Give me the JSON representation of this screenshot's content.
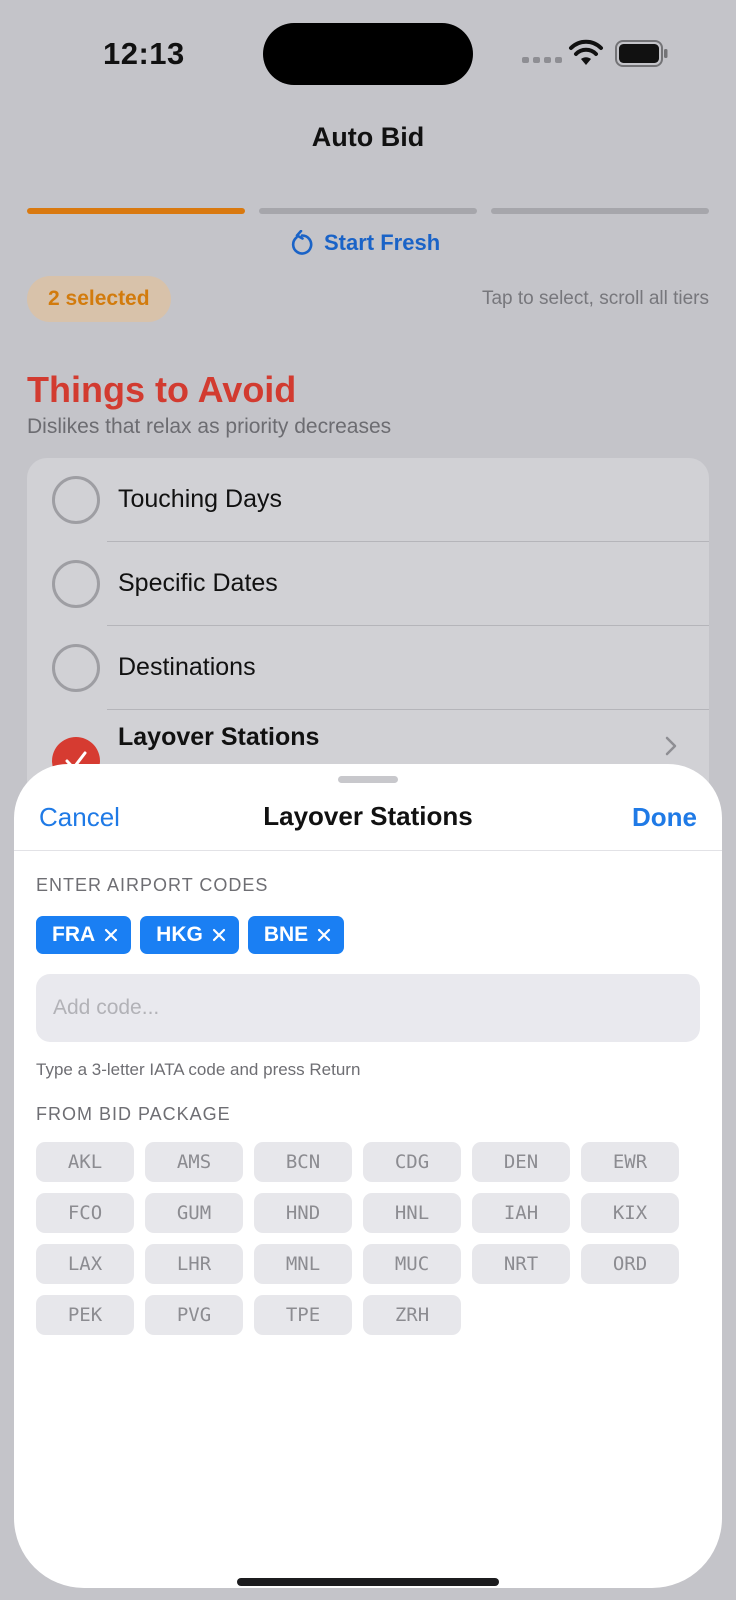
{
  "status_bar": {
    "time": "12:13"
  },
  "nav": {
    "title": "Auto Bid"
  },
  "progress": {
    "steps_total": 3,
    "steps_completed": 1
  },
  "start_fresh": {
    "label": "Start Fresh",
    "icon": "reset-icon"
  },
  "selection": {
    "count_label": "2 selected",
    "hint": "Tap to select, scroll all tiers"
  },
  "section": {
    "title": "Things to Avoid",
    "subtitle": "Dislikes that relax as priority decreases",
    "items": [
      {
        "label": "Touching Days",
        "checked": false
      },
      {
        "label": "Specific Dates",
        "checked": false
      },
      {
        "label": "Destinations",
        "checked": false
      },
      {
        "label": "Layover Stations",
        "checked": true
      }
    ]
  },
  "sheet": {
    "cancel_label": "Cancel",
    "title": "Layover Stations",
    "done_label": "Done",
    "enter_label": "ENTER AIRPORT CODES",
    "chips": [
      {
        "code": "FRA"
      },
      {
        "code": "HKG"
      },
      {
        "code": "BNE"
      }
    ],
    "input": {
      "value": "",
      "placeholder": "Add code..."
    },
    "helper": "Type a 3-letter IATA code and press Return",
    "package_label": "FROM BID PACKAGE",
    "package_codes": [
      "AKL",
      "AMS",
      "BCN",
      "CDG",
      "DEN",
      "EWR",
      "FCO",
      "GUM",
      "HND",
      "HNL",
      "IAH",
      "KIX",
      "LAX",
      "LHR",
      "MNL",
      "MUC",
      "NRT",
      "ORD",
      "PEK",
      "PVG",
      "TPE",
      "ZRH"
    ]
  },
  "colors": {
    "accent_blue": "#1f7ae6",
    "chip_blue": "#1a7ff3",
    "avoid_red": "#d23b30",
    "progress_orange": "#d9790f"
  }
}
